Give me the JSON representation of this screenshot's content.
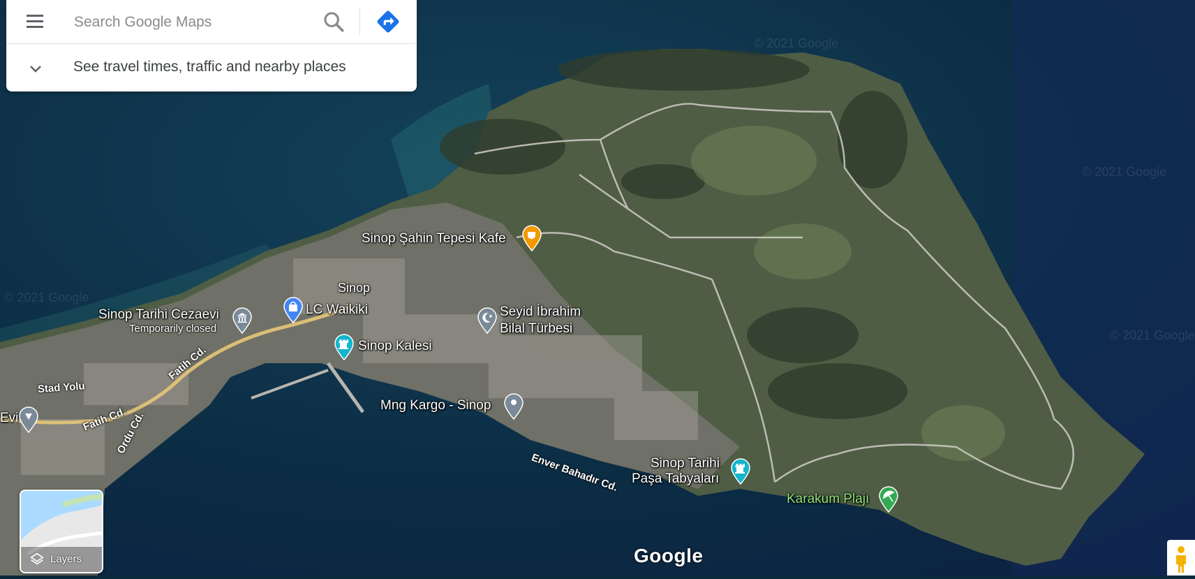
{
  "search": {
    "placeholder": "Search Google Maps",
    "travel_hint": "See travel times, traffic and nearby places"
  },
  "places": {
    "cafe": "Sinop Şahin Tepesi Kafe",
    "city": "Sinop",
    "prison": "Sinop Tarihi Cezaevi",
    "prison_status": "Temporarily closed",
    "waikiki": "LC Waikiki",
    "tomb_line1": "Seyid İbrahim",
    "tomb_line2": "Bilal Türbesi",
    "castle": "Sinop Kalesi",
    "cargo": "Mng Kargo - Sinop",
    "bastion_line1": "Sinop Tarihi",
    "bastion_line2": "Paşa Tabyaları",
    "beach": "Karakum Plajı",
    "evi": "Evi"
  },
  "roads": {
    "fatih1": "Fatih Cd.",
    "fatih2": "Fatih Cd.",
    "stad": "Stad Yolu",
    "ordu": "Ordu Cd.",
    "enver": "Enver Bahadır Cd."
  },
  "controls": {
    "layers_label": "Layers"
  },
  "branding": {
    "google": "Google",
    "watermark": "© 2021 Google"
  },
  "colors": {
    "sea": "#0b2a3c",
    "land": "#4a5a42",
    "pin_blue": "#4285f4",
    "pin_teal": "#12b5cb",
    "pin_orange": "#f29900",
    "pin_green": "#34a853",
    "pin_gray": "#7a8a99"
  },
  "icons": {
    "menu": "hamburger-menu-icon",
    "search": "search-icon",
    "directions": "directions-icon",
    "chevron": "chevron-down-icon",
    "layers": "layers-icon",
    "pegman": "pegman-icon"
  }
}
